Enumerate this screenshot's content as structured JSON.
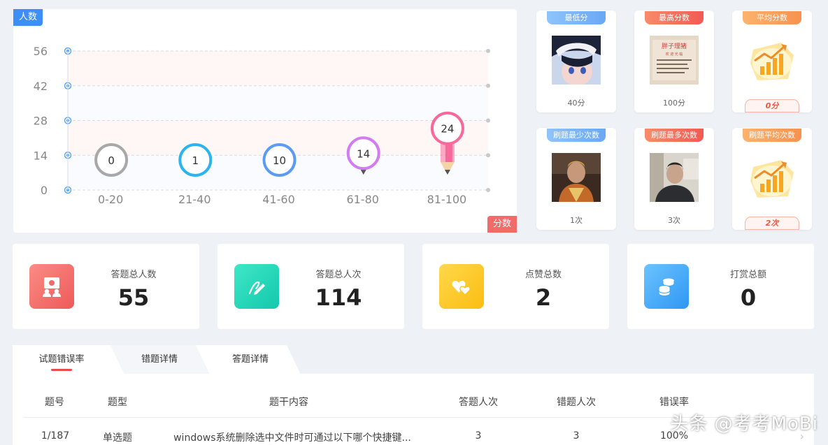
{
  "chart_panel": {
    "y_tag": "人数",
    "x_tag": "分数"
  },
  "chart_data": {
    "type": "bar",
    "categories": [
      "0-20",
      "21-40",
      "41-60",
      "61-80",
      "81-100"
    ],
    "values": [
      0,
      1,
      10,
      14,
      24
    ],
    "yticks": [
      0,
      14,
      28,
      42,
      56
    ],
    "ylim": [
      0,
      56
    ],
    "xlabel": "分数",
    "ylabel": "人数",
    "grid": true,
    "colors": [
      "#a8a8a8",
      "#2bb4ee",
      "#5b9bf3",
      "#d27cf1",
      "#f7699a"
    ]
  },
  "user_cards": [
    {
      "badge": "最低分",
      "value": "40分",
      "color": "blue",
      "photo": "anime-avatar"
    },
    {
      "badge": "最高分数",
      "value": "100分",
      "color": "red",
      "photo": "shop-sign"
    },
    {
      "badge": "平均分数",
      "value": "0分",
      "color": "orange",
      "photo": "bar-chart-illustration"
    },
    {
      "badge": "刷题最少次数",
      "value": "1次",
      "color": "blue",
      "photo": "monk-avatar"
    },
    {
      "badge": "刷题最多次数",
      "value": "3次",
      "color": "red",
      "photo": "man-avatar"
    },
    {
      "badge": "刷题平均次数",
      "value": "2次",
      "color": "orange",
      "photo": "bar-chart-illustration"
    }
  ],
  "stats": [
    {
      "label": "答题总人数",
      "value": "55",
      "icon": "people-icon",
      "color": "#f26b6b"
    },
    {
      "label": "答题总人次",
      "value": "114",
      "icon": "edit-icon",
      "color": "#1cd6b8"
    },
    {
      "label": "点赞总数",
      "value": "2",
      "icon": "hearts-icon",
      "color": "#fbc21b"
    },
    {
      "label": "打赏总额",
      "value": "0",
      "icon": "coins-icon",
      "color": "#3ea6f8"
    }
  ],
  "tabs": [
    "试题错误率",
    "错题详情",
    "答题详情"
  ],
  "table": {
    "headers": [
      "题号",
      "题型",
      "题干内容",
      "答题人次",
      "错题人次",
      "错误率"
    ],
    "rows": [
      [
        "1/187",
        "单选题",
        "windows系统删除选中文件时可通过以下哪个快捷键...",
        "3",
        "3",
        "100%"
      ]
    ]
  },
  "watermark": "头条 @考考MoBi"
}
